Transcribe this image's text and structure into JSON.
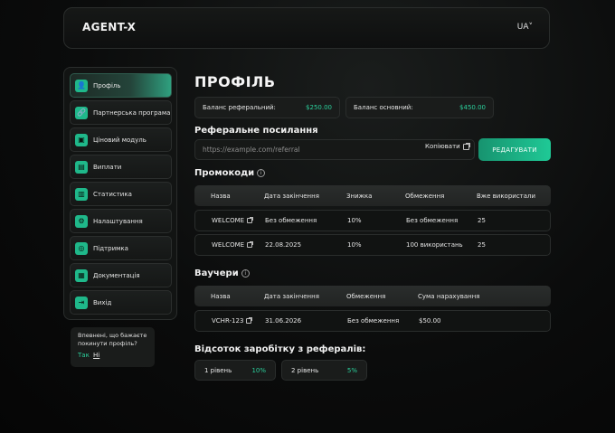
{
  "header": {
    "logo": "AGENT-X",
    "language": "UA˅"
  },
  "sidebar": {
    "items": [
      {
        "label": "Профіль",
        "icon": "user-icon",
        "glyph": "👤",
        "active": true
      },
      {
        "label": "Партнерська програма",
        "icon": "link-icon",
        "glyph": "🔗",
        "active": false
      },
      {
        "label": "Ціновий модуль",
        "icon": "price-tag-icon",
        "glyph": "▣",
        "active": false
      },
      {
        "label": "Виплати",
        "icon": "wallet-icon",
        "glyph": "▤",
        "active": false
      },
      {
        "label": "Статистика",
        "icon": "bar-chart-icon",
        "glyph": "▥",
        "active": false
      },
      {
        "label": "Налаштування",
        "icon": "gear-icon",
        "glyph": "⚙",
        "active": false
      },
      {
        "label": "Підтримка",
        "icon": "headset-icon",
        "glyph": "◎",
        "active": false
      },
      {
        "label": "Документація",
        "icon": "document-icon",
        "glyph": "▦",
        "active": false
      },
      {
        "label": "Вихід",
        "icon": "exit-icon",
        "glyph": "⇥",
        "active": false
      }
    ]
  },
  "confirm": {
    "question": "Впевнені, що бажаєте покинути профіль?",
    "yes": "Так",
    "no": "Ні"
  },
  "page": {
    "title": "ПРОФІЛЬ"
  },
  "balances": [
    {
      "label": "Баланс реферальний:",
      "value": "$250.00"
    },
    {
      "label": "Баланс основний:",
      "value": "$450.00"
    }
  ],
  "referral": {
    "title": "Реферальне посилання",
    "placeholder": "https://example.com/referral",
    "copy_label": "Копіювати",
    "edit_label": "РЕДАГУВАТИ"
  },
  "promocodes": {
    "title": "Промокоди",
    "columns": [
      "Назва",
      "Дата закінчення",
      "Знижка",
      "Обмеження",
      "Вже використали"
    ],
    "rows": [
      [
        "WELCOME",
        "Без обмеження",
        "10%",
        "Без обмеження",
        "25"
      ],
      [
        "WELCOME",
        "22.08.2025",
        "10%",
        "100 використань",
        "25"
      ]
    ]
  },
  "vouchers": {
    "title": "Ваучери",
    "columns": [
      "Назва",
      "Дата закінчення",
      "Обмеження",
      "Сума нарахування"
    ],
    "rows": [
      [
        "VCHR-123",
        "31.06.2026",
        "Без обмеження",
        "$50.00"
      ]
    ]
  },
  "earnings": {
    "title": "Відсоток заробітку з рефералів:",
    "levels": [
      {
        "label": "1 рівень",
        "value": "10%"
      },
      {
        "label": "2 рівень",
        "value": "5%"
      }
    ]
  },
  "colors": {
    "accent": "#2bd09c",
    "button": "#1fc996"
  }
}
